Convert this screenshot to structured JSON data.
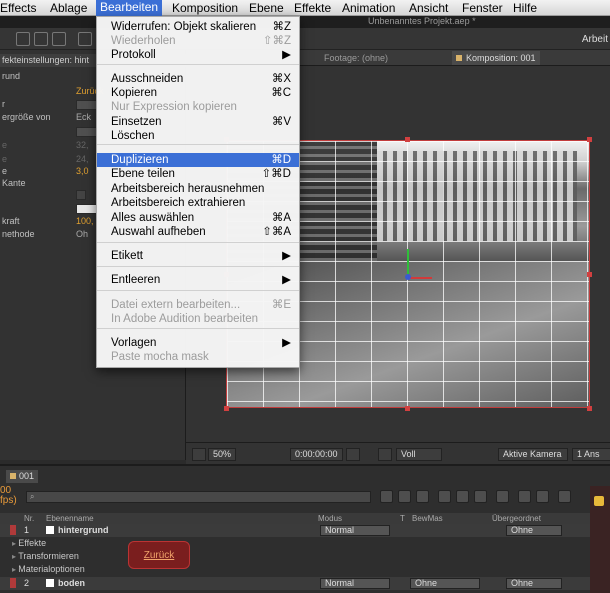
{
  "menubar": {
    "items": [
      "Effects",
      "Ablage",
      "Bearbeiten",
      "Komposition",
      "Ebene",
      "Effekte",
      "Animation",
      "Ansicht",
      "Fenster",
      "Hilfe"
    ],
    "selected": "Bearbeiten"
  },
  "window_title": "Unbenanntes Projekt.aep *",
  "toolbar": {
    "workspace_label": "Arbeit"
  },
  "effect_controls": {
    "tab_label": "fekteinstellungen: hint",
    "layer_name": "rund",
    "reset_label": "Zurück",
    "rows": [
      {
        "label": "r",
        "value": ""
      },
      {
        "label": "ergröße von",
        "value": "Eck"
      },
      {
        "label": "e",
        "value": "32,"
      },
      {
        "label": "e",
        "value": "24,"
      },
      {
        "label": "e",
        "value": "3,0"
      },
      {
        "label": "Kante",
        "value": ""
      },
      {
        "label": "",
        "value": ""
      },
      {
        "label": "kraft",
        "value": "100,"
      },
      {
        "label": "nethode",
        "value": "Oh"
      }
    ]
  },
  "comp_tabs": {
    "footage": "Footage: (ohne)",
    "composition": "Komposition: 001"
  },
  "viewer_bar": {
    "zoom": "50%",
    "timecode": "0:00:00:00",
    "resolution": "Voll",
    "camera": "Aktive Kamera",
    "views": "1 Ans"
  },
  "timeline": {
    "tab_label": "001",
    "fps_label": "00\nfps)",
    "search_placeholder": "",
    "headers": {
      "nr": "Nr.",
      "name": "Ebenenname",
      "modus": "Modus",
      "t": "T",
      "bewmas": "BewMas",
      "parent": "Übergeordnet"
    },
    "layers": [
      {
        "nr": "1",
        "name": "hintergrund",
        "mode": "Normal",
        "trkmat": "",
        "parent": "Ohne"
      },
      {
        "nr": "2",
        "name": "boden",
        "mode": "Normal",
        "trkmat": "Ohne",
        "parent": "Ohne"
      }
    ],
    "sub_groups": [
      "Effekte",
      "Transformieren",
      "Materialoptionen"
    ],
    "reset_label": "Zurück"
  },
  "edit_menu": {
    "items": [
      {
        "label": "Widerrufen: Objekt skalieren",
        "shortcut": "⌘Z",
        "enabled": true
      },
      {
        "label": "Wiederholen",
        "shortcut": "⇧⌘Z",
        "enabled": false
      },
      {
        "label": "Protokoll",
        "shortcut": "▶",
        "enabled": true
      },
      {
        "label": "Ausschneiden",
        "shortcut": "⌘X",
        "enabled": true
      },
      {
        "label": "Kopieren",
        "shortcut": "⌘C",
        "enabled": true
      },
      {
        "label": "Nur Expression kopieren",
        "shortcut": "",
        "enabled": false
      },
      {
        "label": "Einsetzen",
        "shortcut": "⌘V",
        "enabled": true
      },
      {
        "label": "Löschen",
        "shortcut": "",
        "enabled": true
      },
      {
        "label": "Duplizieren",
        "shortcut": "⌘D",
        "enabled": true,
        "highlighted": true
      },
      {
        "label": "Ebene teilen",
        "shortcut": "⇧⌘D",
        "enabled": true
      },
      {
        "label": "Arbeitsbereich herausnehmen",
        "shortcut": "",
        "enabled": true
      },
      {
        "label": "Arbeitsbereich extrahieren",
        "shortcut": "",
        "enabled": true
      },
      {
        "label": "Alles auswählen",
        "shortcut": "⌘A",
        "enabled": true
      },
      {
        "label": "Auswahl aufheben",
        "shortcut": "⇧⌘A",
        "enabled": true
      },
      {
        "label": "Etikett",
        "shortcut": "▶",
        "enabled": true
      },
      {
        "label": "Entleeren",
        "shortcut": "▶",
        "enabled": true
      },
      {
        "label": "Datei extern bearbeiten...",
        "shortcut": "⌘E",
        "enabled": false
      },
      {
        "label": "In Adobe Audition bearbeiten",
        "shortcut": "",
        "enabled": false
      },
      {
        "label": "Vorlagen",
        "shortcut": "▶",
        "enabled": true
      },
      {
        "label": "Paste mocha mask",
        "shortcut": "",
        "enabled": false
      }
    ]
  },
  "colors": {
    "menu_highlight": "#3b6fd6",
    "handle_red": "#d24040",
    "reset_orange": "#f0a36a",
    "label_gold": "#d9b36a"
  }
}
